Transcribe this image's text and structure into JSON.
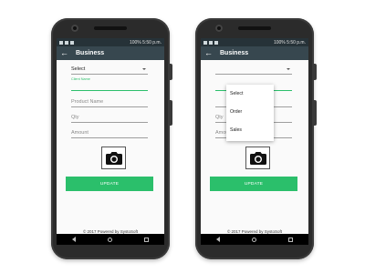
{
  "status_bar": {
    "text": "100% 5:50 p.m."
  },
  "app_bar": {
    "title": "Business"
  },
  "form": {
    "select_value": "Select",
    "client_label": "Client Name",
    "product_placeholder": "Product Name",
    "qty_placeholder": "Qty",
    "amount_placeholder": "Amount",
    "update_label": "UPDATE"
  },
  "footer_text": "© 2017 Powered by SystoSoft",
  "dropdown_options": [
    "Select",
    "Order",
    "Sales"
  ],
  "colors": {
    "accent": "#2bbf6b",
    "app_bar": "#37474f",
    "status_bar": "#263238"
  }
}
